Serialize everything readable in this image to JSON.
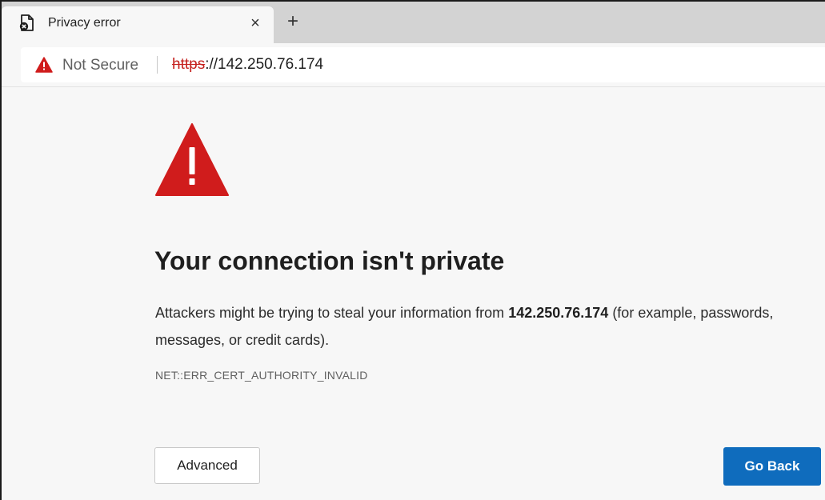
{
  "browser": {
    "tab": {
      "title": "Privacy error",
      "close_label": "×",
      "icon": "page-error-icon"
    },
    "new_tab_label": "+",
    "address_bar": {
      "security_label": "Not Secure",
      "security_icon": "warning-triangle-icon",
      "url_scheme": "https",
      "url_rest": "://142.250.76.174"
    }
  },
  "page": {
    "warning_icon": "warning-triangle-icon",
    "heading": "Your connection isn't private",
    "message_before": "Attackers might be trying to steal your information from ",
    "host": "142.250.76.174",
    "message_after": " (for example, passwords, messages, or credit cards).",
    "error_code": "NET::ERR_CERT_AUTHORITY_INVALID",
    "advanced_label": "Advanced",
    "go_back_label": "Go Back"
  },
  "colors": {
    "warning_red": "#d01c1c",
    "primary_button": "#0f6cbd",
    "strike_red": "#c5221f"
  }
}
